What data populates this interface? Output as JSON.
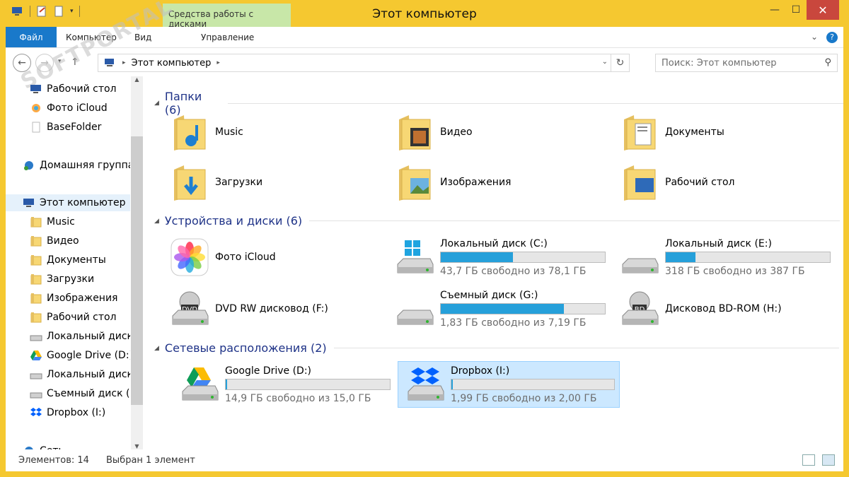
{
  "window": {
    "title": "Этот компьютер",
    "context_tab": "Средства работы с дисками"
  },
  "ribbon": {
    "tabs": [
      "Файл",
      "Компьютер",
      "Вид",
      "Управление"
    ]
  },
  "address": {
    "crumb": "Этот компьютер",
    "search_placeholder": "Поиск: Этот компьютер"
  },
  "watermark": "SOFTPORTAL",
  "sidebar": {
    "items": [
      {
        "label": "Рабочий стол",
        "icon": "desktop-icon"
      },
      {
        "label": "Фото iCloud",
        "icon": "photos-icon"
      },
      {
        "label": "BaseFolder",
        "icon": "file-icon"
      },
      {
        "label": "Домашняя группа",
        "icon": "homegroup-icon"
      },
      {
        "label": "Этот компьютер",
        "icon": "computer-icon"
      },
      {
        "label": "Music",
        "icon": "folder-icon"
      },
      {
        "label": "Видео",
        "icon": "folder-icon"
      },
      {
        "label": "Документы",
        "icon": "folder-icon"
      },
      {
        "label": "Загрузки",
        "icon": "folder-icon"
      },
      {
        "label": "Изображения",
        "icon": "folder-icon"
      },
      {
        "label": "Рабочий стол",
        "icon": "folder-icon"
      },
      {
        "label": "Локальный диск",
        "icon": "drive-icon"
      },
      {
        "label": "Google Drive (D:)",
        "icon": "google-drive-icon"
      },
      {
        "label": "Локальный диск",
        "icon": "drive-icon"
      },
      {
        "label": "Съемный диск (G",
        "icon": "removable-drive-icon"
      },
      {
        "label": "Dropbox (I:)",
        "icon": "dropbox-icon"
      },
      {
        "label": "Сеть",
        "icon": "network-icon"
      }
    ]
  },
  "groups": {
    "folders": {
      "title": "Папки (6)"
    },
    "devices": {
      "title": "Устройства и диски (6)"
    },
    "network": {
      "title": "Сетевые расположения (2)"
    }
  },
  "folders": [
    {
      "name": "Music",
      "icon": "music-folder-icon"
    },
    {
      "name": "Видео",
      "icon": "video-folder-icon"
    },
    {
      "name": "Документы",
      "icon": "documents-folder-icon"
    },
    {
      "name": "Загрузки",
      "icon": "downloads-folder-icon"
    },
    {
      "name": "Изображения",
      "icon": "pictures-folder-icon"
    },
    {
      "name": "Рабочий стол",
      "icon": "desktop-folder-icon"
    }
  ],
  "devices": [
    {
      "name": "Фото iCloud",
      "icon": "icloud-photos-icon"
    },
    {
      "name": "Локальный диск (C:)",
      "free": "43,7 ГБ свободно из 78,1 ГБ",
      "used_fraction": 0.44,
      "icon": "windows-drive-icon"
    },
    {
      "name": "Локальный диск (E:)",
      "free": "318 ГБ свободно из 387 ГБ",
      "used_fraction": 0.18,
      "icon": "hard-drive-icon"
    },
    {
      "name": "DVD RW дисковод (F:)",
      "icon": "dvd-drive-icon"
    },
    {
      "name": "Съемный диск (G:)",
      "free": "1,83 ГБ свободно из 7,19 ГБ",
      "used_fraction": 0.75,
      "icon": "removable-drive-icon"
    },
    {
      "name": "Дисковод BD-ROM (H:)",
      "icon": "bd-drive-icon"
    }
  ],
  "network": [
    {
      "name": "Google Drive (D:)",
      "free": "14,9 ГБ свободно из 15,0 ГБ",
      "used_fraction": 0.01,
      "icon": "google-drive-icon"
    },
    {
      "name": "Dropbox (I:)",
      "free": "1,99 ГБ свободно из 2,00 ГБ",
      "used_fraction": 0.01,
      "icon": "dropbox-icon"
    }
  ],
  "status": {
    "count": "Элементов: 14",
    "selected": "Выбран 1 элемент"
  },
  "colors": {
    "titlebar": "#f5c830",
    "accent": "#1979ca",
    "bar_fill": "#26a0da",
    "group_title": "#1e3287"
  }
}
